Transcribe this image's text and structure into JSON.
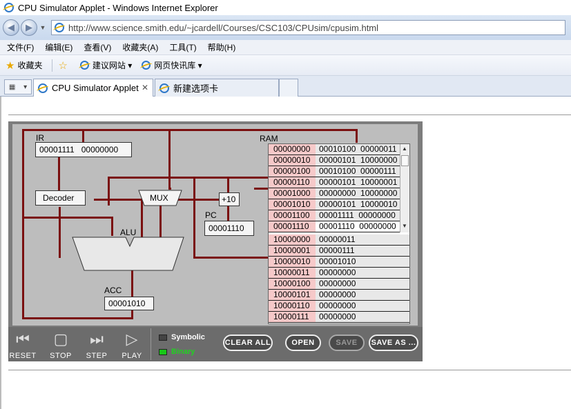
{
  "window": {
    "title": "CPU Simulator Applet - Windows Internet Explorer"
  },
  "address_bar": {
    "url": "http://www.science.smith.edu/~jcardell/Courses/CSC103/CPUsim/cpusim.html"
  },
  "menu": [
    "文件(F)",
    "编辑(E)",
    "查看(V)",
    "收藏夹(A)",
    "工具(T)",
    "帮助(H)"
  ],
  "favorites_bar": {
    "favorites": "收藏夹",
    "suggested_sites": "建议网站 ▾",
    "web_slices": "网页快讯库 ▾"
  },
  "tabs": {
    "active": "CPU Simulator Applet",
    "new_tab": "新建选项卡"
  },
  "applet": {
    "ir": {
      "label": "IR",
      "value": "00001111   00000000"
    },
    "decoder": {
      "label": "Decoder"
    },
    "mux": {
      "label": "MUX"
    },
    "plus10": {
      "label": "+10"
    },
    "pc": {
      "label": "PC",
      "value": "00001110"
    },
    "alu": {
      "label": "ALU"
    },
    "acc": {
      "label": "ACC",
      "value": "00001010"
    },
    "ram": {
      "label": "RAM",
      "rows": [
        {
          "addr": "00000000",
          "val": "00010100  00000011"
        },
        {
          "addr": "00000010",
          "val": "00000101  10000000"
        },
        {
          "addr": "00000100",
          "val": "00010100  00000111"
        },
        {
          "addr": "00000110",
          "val": "00000101  10000001"
        },
        {
          "addr": "00001000",
          "val": "00000000  10000000"
        },
        {
          "addr": "00001010",
          "val": "00000101  10000010"
        },
        {
          "addr": "00001100",
          "val": "00001111  00000000"
        },
        {
          "addr": "00001110",
          "val": "00001110  00000000"
        }
      ],
      "data_rows": [
        {
          "addr": "10000000",
          "val": "00000011"
        },
        {
          "addr": "10000001",
          "val": "00000111"
        },
        {
          "addr": "10000010",
          "val": "00001010"
        },
        {
          "addr": "10000011",
          "val": "00000000"
        },
        {
          "addr": "10000100",
          "val": "00000000"
        },
        {
          "addr": "10000101",
          "val": "00000000"
        },
        {
          "addr": "10000110",
          "val": "00000000"
        },
        {
          "addr": "10000111",
          "val": "00000000"
        }
      ]
    },
    "controls": {
      "reset": "RESET",
      "stop": "STOP",
      "step": "STEP",
      "play": "PLAY"
    },
    "modes": {
      "symbolic": "Symbolic",
      "binary": "Binary"
    },
    "buttons": {
      "clear_all": "CLEAR ALL",
      "open": "OPEN",
      "save": "SAVE",
      "save_as": "SAVE AS ..."
    }
  }
}
